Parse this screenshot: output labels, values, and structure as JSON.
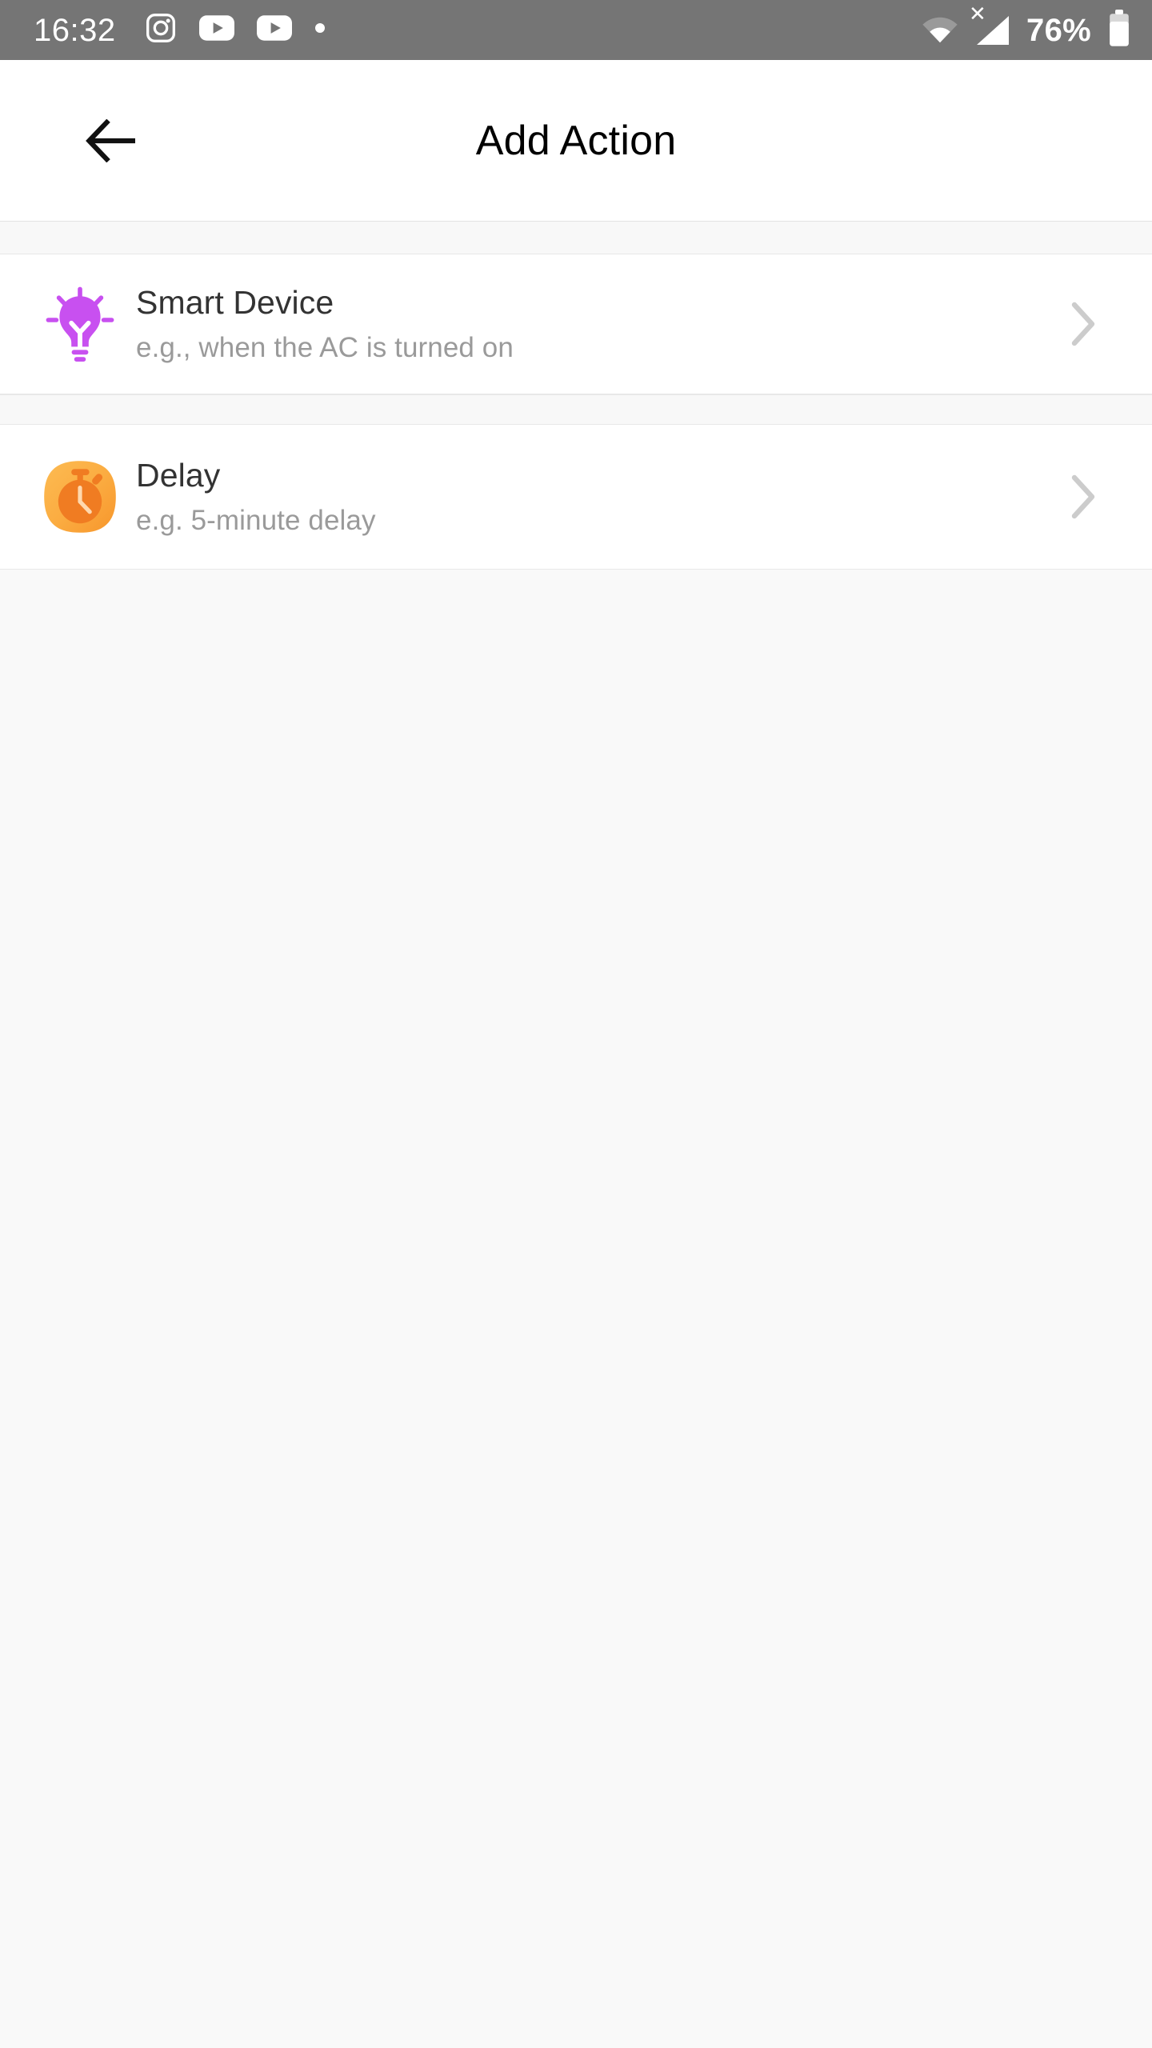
{
  "status_bar": {
    "time": "16:32",
    "battery_percent": "76%",
    "background_color": "#757575",
    "notification_icons": [
      {
        "name": "instagram-icon",
        "label": "Instagram"
      },
      {
        "name": "youtube-icon",
        "label": "YouTube"
      },
      {
        "name": "youtube-icon",
        "label": "YouTube"
      },
      {
        "name": "more-notifications-dot-icon",
        "label": "More notifications"
      }
    ],
    "system_icons": [
      {
        "name": "wifi-icon",
        "label": "Wi-Fi"
      },
      {
        "name": "signal-no-service-icon",
        "label": "No service",
        "badge": "X"
      },
      {
        "name": "battery-icon",
        "label": "Battery"
      }
    ]
  },
  "header": {
    "title": "Add Action",
    "back_label": "Back",
    "title_color": "#000000",
    "background_color": "#ffffff"
  },
  "list": {
    "items": [
      {
        "title": "Smart Device",
        "subtitle": "e.g., when the AC is turned on",
        "icon": "lightbulb-icon",
        "icon_color": "#c850f0",
        "chevron": "chevron-right-icon"
      },
      {
        "title": "Delay",
        "subtitle": "e.g. 5-minute delay",
        "icon": "stopwatch-icon",
        "icon_color": "#f79a2e",
        "chevron": "chevron-right-icon"
      }
    ]
  },
  "theme": {
    "page_background": "#f9f9f9",
    "row_background": "#ffffff",
    "band_background": "#f8f8f8",
    "divider_color": "#e8e8e8",
    "title_text_color": "#333333",
    "subtitle_text_color": "#9a9a9a",
    "chevron_color": "#cccccc"
  }
}
